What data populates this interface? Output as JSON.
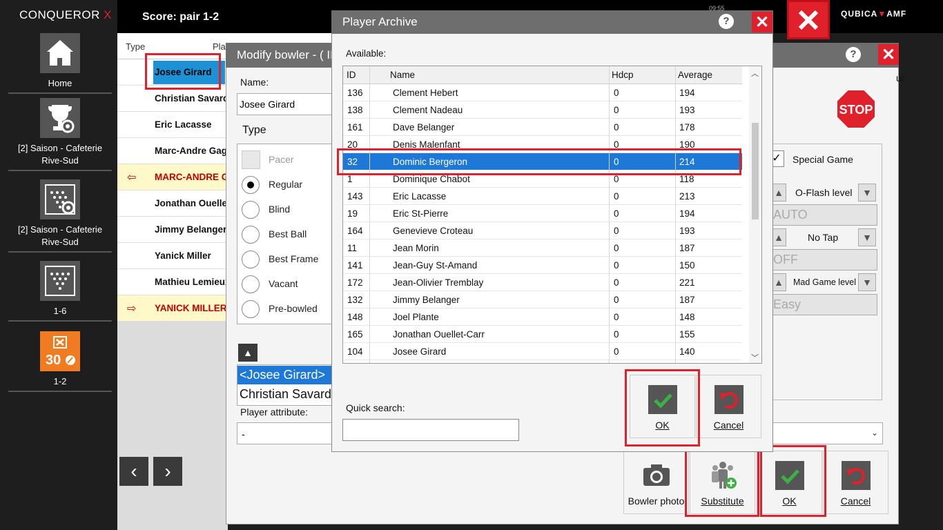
{
  "brand": {
    "name": "CONQUEROR",
    "x": "X"
  },
  "topbar": {
    "score": "Score: pair 1-2",
    "clock": "09:55",
    "qamf_left": "QUBICA",
    "qamf_mid": "▼",
    "qamf_right": "AMF"
  },
  "sidebar": {
    "items": [
      {
        "label": "Home",
        "icon": "home-icon"
      },
      {
        "label": "[2] Saison - Cafeterie Rive-Sud",
        "icon": "trophy-settings-icon"
      },
      {
        "label": "[2] Saison - Cafeterie Rive-Sud",
        "icon": "pins-settings-icon"
      },
      {
        "label": "1-6",
        "icon": "pins-icon"
      },
      {
        "label": "1-2",
        "icon": "scoresheet-icon"
      }
    ]
  },
  "bgtable": {
    "col_type": "Type",
    "col_player": "Play",
    "rows": [
      {
        "name": "Josee Girard",
        "arrow": ""
      },
      {
        "name": "Christian Savard",
        "arrow": ""
      },
      {
        "name": "Eric Lacasse",
        "arrow": ""
      },
      {
        "name": "Marc-Andre Gagne",
        "arrow": ""
      },
      {
        "name": "MARC-ANDRE GAGNE",
        "arrow": "⇦"
      },
      {
        "name": "Jonathan Ouellet-Carr",
        "arrow": ""
      },
      {
        "name": "Jimmy Belanger",
        "arrow": ""
      },
      {
        "name": "Yanick Miller",
        "arrow": ""
      },
      {
        "name": "Mathieu Lemieux",
        "arrow": ""
      },
      {
        "name": "YANICK MILLER",
        "arrow": "⇨"
      }
    ]
  },
  "modify": {
    "title": "Modify bowler - ( ID",
    "name_label": "Name:",
    "name_value": "Josee Girard",
    "type_label": "Type",
    "types": [
      "Pacer",
      "Regular",
      "Blind",
      "Best Ball",
      "Best Frame",
      "Vacant",
      "Pre-bowled"
    ],
    "list": [
      "<Josee Girard>",
      "Christian Savard"
    ],
    "attr_label": "Player attribute:",
    "attr_value": "-",
    "special_label": "Special Game",
    "special_check": "✓",
    "oflash_label": "O-Flash level",
    "oflash_value": "AUTO",
    "notap_label": "No Tap",
    "notap_value": "OFF",
    "mad_label": "Mad Game level",
    "mad_value": "Easy",
    "partial_right": "ur",
    "stop_label": "STOP",
    "bowler_photo": "Bowler photo",
    "substitute": "Substitute",
    "ok": "OK",
    "cancel": "Cancel"
  },
  "archive": {
    "title": "Player Archive",
    "available_label": "Available:",
    "headers": {
      "id": "ID",
      "name": "Name",
      "hdcp": "Hdcp",
      "average": "Average"
    },
    "rows": [
      {
        "id": "136",
        "name": "Clement Hebert",
        "hdcp": "0",
        "avg": "194"
      },
      {
        "id": "138",
        "name": "Clement Nadeau",
        "hdcp": "0",
        "avg": "193"
      },
      {
        "id": "161",
        "name": "Dave Belanger",
        "hdcp": "0",
        "avg": "178"
      },
      {
        "id": "20",
        "name": "Denis Malenfant",
        "hdcp": "0",
        "avg": "190"
      },
      {
        "id": "32",
        "name": "Dominic Bergeron",
        "hdcp": "0",
        "avg": "214"
      },
      {
        "id": "1",
        "name": "Dominique Chabot",
        "hdcp": "0",
        "avg": "118"
      },
      {
        "id": "143",
        "name": "Eric Lacasse",
        "hdcp": "0",
        "avg": "213"
      },
      {
        "id": "19",
        "name": "Eric St-Pierre",
        "hdcp": "0",
        "avg": "194"
      },
      {
        "id": "164",
        "name": "Genevieve Croteau",
        "hdcp": "0",
        "avg": "193"
      },
      {
        "id": "11",
        "name": "Jean Morin",
        "hdcp": "0",
        "avg": "187"
      },
      {
        "id": "141",
        "name": "Jean-Guy St-Amand",
        "hdcp": "0",
        "avg": "150"
      },
      {
        "id": "172",
        "name": "Jean-Olivier Tremblay",
        "hdcp": "0",
        "avg": "221"
      },
      {
        "id": "132",
        "name": "Jimmy Belanger",
        "hdcp": "0",
        "avg": "187"
      },
      {
        "id": "148",
        "name": "Joel Plante",
        "hdcp": "0",
        "avg": "148"
      },
      {
        "id": "165",
        "name": "Jonathan Ouellet-Carr",
        "hdcp": "0",
        "avg": "155"
      },
      {
        "id": "104",
        "name": "Josee Girard",
        "hdcp": "0",
        "avg": "140"
      }
    ],
    "selected_index": 4,
    "quick_search_label": "Quick search:",
    "quick_search_value": "",
    "ok": "OK",
    "cancel": "Cancel"
  },
  "colors": {
    "accent_red": "#e0202a",
    "selection_blue": "#1e78d7",
    "ok_green": "#3cb043",
    "highlight_yellow": "#fff8c8",
    "orange": "#f07b20"
  }
}
